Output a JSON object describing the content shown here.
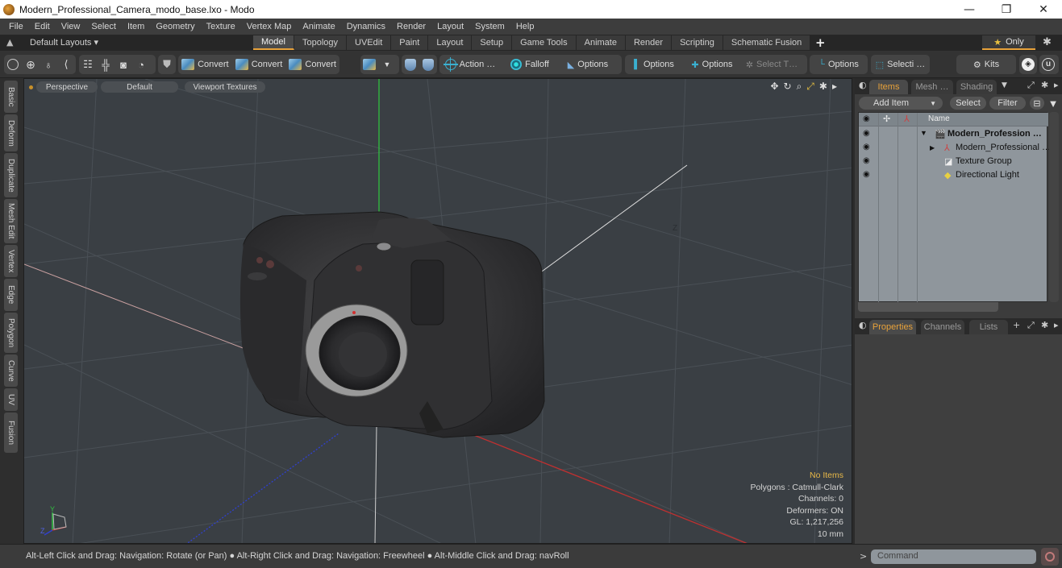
{
  "window": {
    "title": "Modern_Professional_Camera_modo_base.lxo - Modo",
    "controls": {
      "minimize": "—",
      "restore": "❐",
      "close": "✕"
    }
  },
  "menubar": [
    "File",
    "Edit",
    "View",
    "Select",
    "Item",
    "Geometry",
    "Texture",
    "Vertex Map",
    "Animate",
    "Dynamics",
    "Render",
    "Layout",
    "System",
    "Help"
  ],
  "layoutbar": {
    "layouts_label": "Default Layouts ▾",
    "tabs": [
      "Model",
      "Topology",
      "UVEdit",
      "Paint",
      "Layout",
      "Setup",
      "Game Tools",
      "Animate",
      "Render",
      "Scripting",
      "Schematic Fusion"
    ],
    "active_tab": "Model",
    "add_tab": "+",
    "only_label": "Only",
    "star": "★",
    "gear": "✱"
  },
  "toolbar": {
    "convert_1": "Convert",
    "convert_2": "Convert",
    "convert_3": "Convert",
    "action": "Action …",
    "falloff": "Falloff",
    "options_1": "Options",
    "options_2": "Options",
    "options_3": "Options",
    "select_t": "Select T…",
    "options_4": "Options",
    "selecti": "Selecti …",
    "kits": "Kits"
  },
  "left_tabs": [
    "Basic",
    "Deform",
    "Duplicate",
    "Mesh Edit",
    "Vertex",
    "Edge",
    "Polygon",
    "Curve",
    "UV",
    "Fusion"
  ],
  "viewport": {
    "view_mode": "Perspective",
    "shading": "Default",
    "textures": "Viewport Textures",
    "tools": [
      "✥",
      "↻",
      "⌕",
      "⤢",
      "✱",
      "▸"
    ],
    "axis_label_z": "Z",
    "gizmo": {
      "y": "Y",
      "z": "Z"
    },
    "info": {
      "items": "No Items",
      "polygons": "Polygons : Catmull-Clark",
      "channels": "Channels: 0",
      "deformers": "Deformers: ON",
      "gl": "GL: 1,217,256",
      "scale": "10 mm"
    }
  },
  "status": {
    "hint": "Alt-Left Click and Drag: Navigation: Rotate (or Pan) ● Alt-Right Click and Drag: Navigation: Freewheel ● Alt-Middle Click and Drag: navRoll"
  },
  "items_panel": {
    "tabs": [
      "Items",
      "Mesh …",
      "Shading"
    ],
    "active_tab": "Items",
    "add_item": "Add Item",
    "select": "Select",
    "filter": "Filter",
    "column_name": "Name",
    "rows": [
      {
        "label": "Modern_Profession …",
        "bold": true,
        "expander": "▼"
      },
      {
        "label": "Modern_Professional …",
        "bold": false,
        "expander": "▶"
      },
      {
        "label": "Texture Group",
        "bold": false,
        "expander": ""
      },
      {
        "label": "Directional Light",
        "bold": false,
        "expander": ""
      }
    ]
  },
  "properties_panel": {
    "tabs": [
      "Properties",
      "Channels",
      "Lists"
    ],
    "active_tab": "Properties",
    "add": "+"
  },
  "command": {
    "prompt": ">",
    "placeholder": "Command"
  },
  "colors": {
    "accent": "#e8a23a",
    "axis_x": "#c03030",
    "axis_y": "#30c040",
    "axis_z": "#3040d0"
  }
}
